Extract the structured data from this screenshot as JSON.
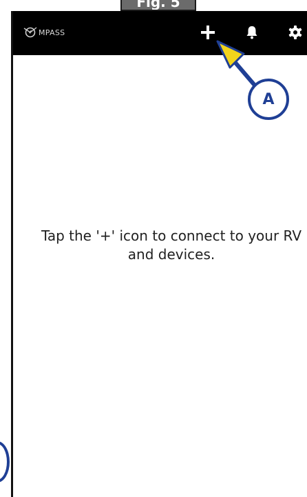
{
  "figure": {
    "tab_label": "Fig. 5"
  },
  "app": {
    "logo_text": "MPASS",
    "logo_icon": "compass-logo-icon",
    "toolbar": {
      "add_icon": "plus-icon",
      "notifications_icon": "bell-icon",
      "settings_icon": "gear-icon"
    }
  },
  "main": {
    "empty_message": "Tap the '+' icon to connect to your RV and devices."
  },
  "callout": {
    "label": "A",
    "color": "#1f3f95",
    "arrow_fill": "#f2d41c"
  },
  "colors": {
    "appbar_bg": "#000000",
    "icon_white": "#ffffff",
    "text": "#1f1f1f"
  }
}
